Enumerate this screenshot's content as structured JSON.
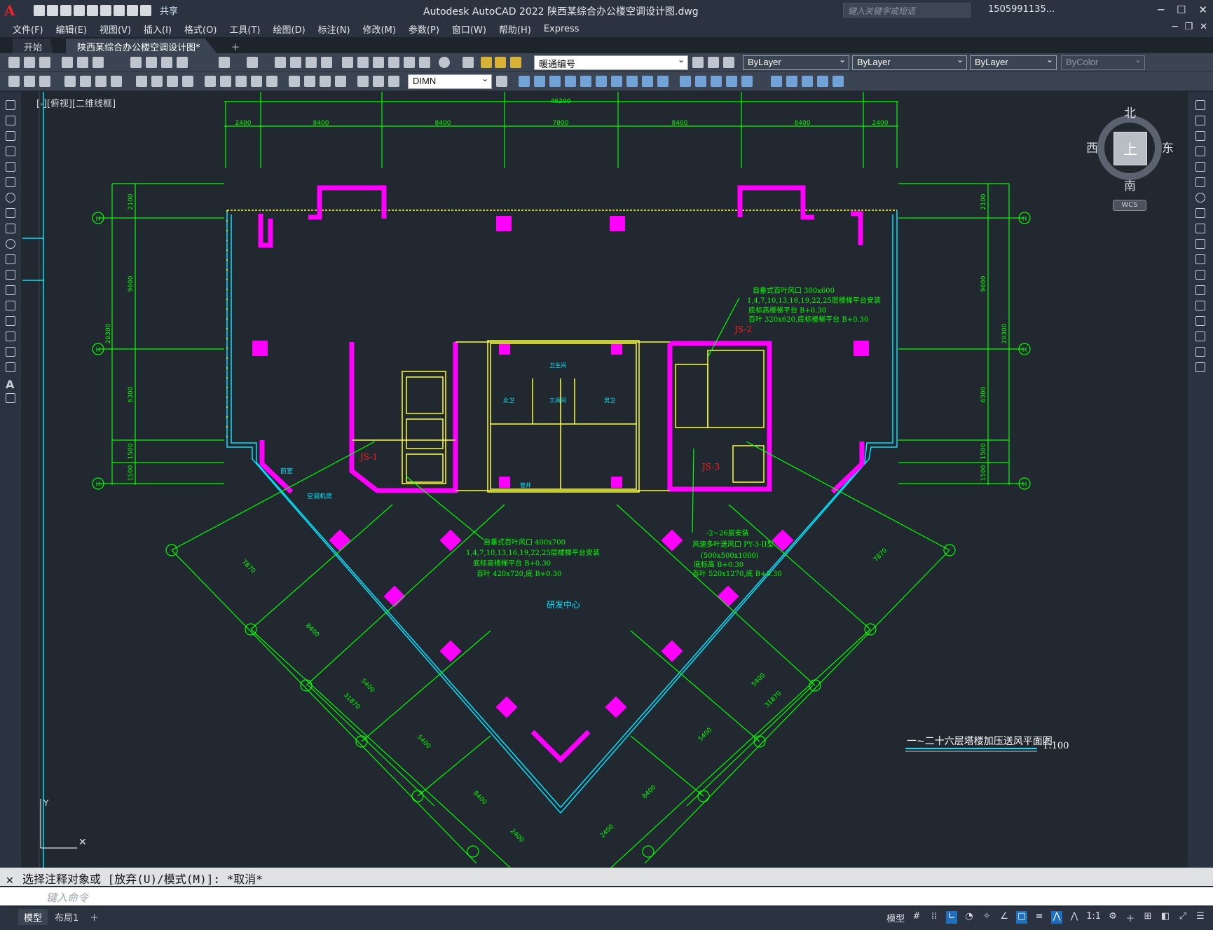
{
  "app": {
    "title": "Autodesk AutoCAD 2022    陕西某综合办公楼空调设计图.dwg",
    "share": "共享",
    "search_placeholder": "键入关键字或短语",
    "user": "1505991135..."
  },
  "menu": [
    "文件(F)",
    "编辑(E)",
    "视图(V)",
    "插入(I)",
    "格式(O)",
    "工具(T)",
    "绘图(D)",
    "标注(N)",
    "修改(M)",
    "参数(P)",
    "窗口(W)",
    "帮助(H)",
    "Express"
  ],
  "tabs": [
    "开始",
    "陕西某综合办公楼空调设计图*"
  ],
  "toolbar": {
    "layer": "暖通编号",
    "color": "ByLayer",
    "linetype": "ByLayer",
    "lineweight": "ByLayer",
    "plotstyle": "ByColor",
    "dimstyle": "DIMN"
  },
  "viewport": {
    "label": "[-][俯视][二维线框]"
  },
  "viewcube": {
    "north": "北",
    "south": "南",
    "east": "东",
    "west": "西",
    "top": "上",
    "wcs": "WCS"
  },
  "drawing": {
    "top_total": "46200",
    "top_dims": [
      "2400",
      "8400",
      "8400",
      "7800",
      "8400",
      "8400",
      "2400"
    ],
    "left_dims": [
      "2100",
      "9600",
      "6300",
      "1500",
      "1500"
    ],
    "left_total": "20300",
    "right_dims": [
      "2100",
      "9600",
      "6300",
      "1500",
      "1500"
    ],
    "right_total": "20300",
    "grid_bubbles": [
      "H",
      "H",
      "H",
      "H",
      "H",
      "H"
    ],
    "note_top_right": [
      "自垂式百叶风口  300x600",
      "1,4,7,10,13,16,19,22,25层楼梯平台安装",
      "底标高楼梯平台  B+0.30",
      "百叶  320x620,底标楼梯平台  B+0.30"
    ],
    "note_center_left": [
      "自垂式百叶风口  400x700",
      "1,4,7,10,13,16,19,22,25层楼梯平台安装",
      "底标高楼梯平台  B+0.30",
      "百叶  420x720,底  B+0.30"
    ],
    "note_center_right": [
      "-2~26层安装",
      "风速多叶送风口  PY-3-II型",
      "(500x500x1000)",
      "底标高  B+0.30",
      "百叶  520x1270,底  B+0.30"
    ],
    "tags": [
      "JS-2",
      "JS-1",
      "JS-3"
    ],
    "rooms": [
      "研发中心",
      "空调机房",
      "前室",
      "卫生间",
      "女卫",
      "男卫",
      "工具间",
      "管井"
    ],
    "diag_dims": [
      "7870",
      "8400",
      "5400",
      "31870",
      "5400",
      "8400",
      "8400",
      "2400",
      "2400",
      "8400",
      "5400",
      "31870",
      "5400",
      "7870"
    ],
    "title": "一~二十六层塔楼加压送风平面图",
    "scale": "1:100"
  },
  "command": {
    "history": "选择注释对象或 [放弃(U)/模式(M)]: *取消*",
    "placeholder": "键入命令"
  },
  "layouts": [
    "模型",
    "布局1"
  ],
  "status": {
    "model": "模型",
    "scale": "1:1"
  },
  "colors": {
    "magenta": "#ff00ff",
    "green": "#00ff00",
    "cyan": "#00e5ff",
    "yellow": "#ffff33",
    "red": "#ff2020",
    "bg": "#212830"
  }
}
